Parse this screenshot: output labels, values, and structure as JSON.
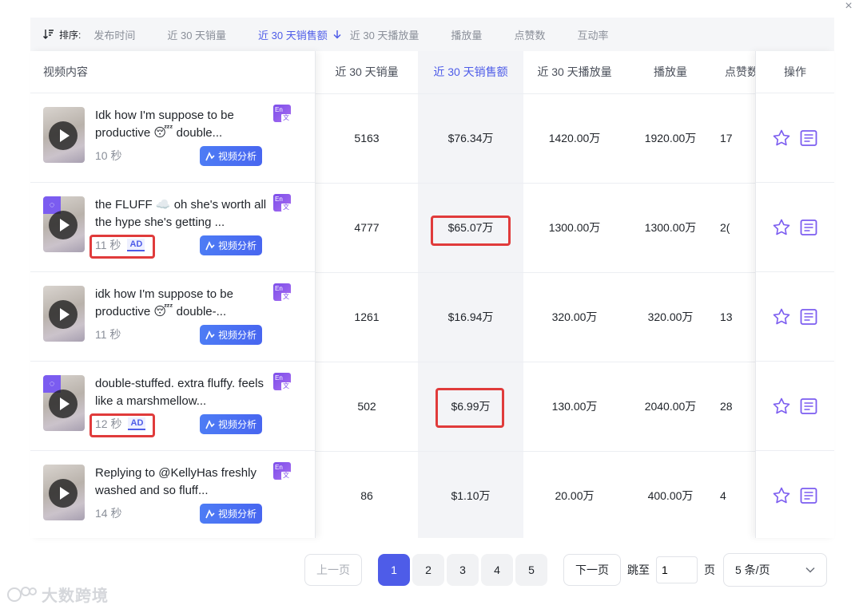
{
  "close_icon": "×",
  "sort": {
    "label": "排序:",
    "options": [
      "发布时间",
      "近 30 天销量",
      "近 30 天销售额",
      "近 30 天播放量",
      "播放量",
      "点赞数",
      "互动率"
    ],
    "active_index": 2
  },
  "table": {
    "left_header": "视频内容",
    "columns": [
      "近 30 天销量",
      "近 30 天销售额",
      "近 30 天播放量",
      "播放量",
      "点赞数"
    ],
    "action_header": "操作",
    "rows": [
      {
        "title": "Idk how I'm suppose to be productive 😴 double...",
        "duration": "10 秒",
        "ad": false,
        "ad_label": "",
        "sales": "5163",
        "revenue": "$76.34万",
        "plays30": "1420.00万",
        "plays": "1920.00万",
        "likes": "17"
      },
      {
        "title": "the FLUFF ☁️ oh she's worth all the hype she's getting ...",
        "duration": "11 秒",
        "ad": true,
        "ad_label": "AD",
        "sales": "4777",
        "revenue": "$65.07万",
        "plays30": "1300.00万",
        "plays": "1300.00万",
        "likes": "2("
      },
      {
        "title": "idk how I'm suppose to be productive 😴 double-...",
        "duration": "11 秒",
        "ad": false,
        "ad_label": "",
        "sales": "1261",
        "revenue": "$16.94万",
        "plays30": "320.00万",
        "plays": "320.00万",
        "likes": "13"
      },
      {
        "title": "double-stuffed. extra fluffy. feels like a marshmellow...",
        "duration": "12 秒",
        "ad": true,
        "ad_label": "AD",
        "sales": "502",
        "revenue": "$6.99万",
        "plays30": "130.00万",
        "plays": "2040.00万",
        "likes": "28"
      },
      {
        "title": "Replying to @KellyHas freshly washed and so fluff...",
        "duration": "14 秒",
        "ad": false,
        "ad_label": "",
        "sales": "86",
        "revenue": "$1.10万",
        "plays30": "20.00万",
        "plays": "400.00万",
        "likes": "4"
      }
    ],
    "analyze_label": "视频分析",
    "translate_top": "En",
    "translate_bottom": "文"
  },
  "pagination": {
    "prev": "上一页",
    "pages": [
      "1",
      "2",
      "3",
      "4",
      "5"
    ],
    "current": "1",
    "next": "下一页",
    "jump_label": "跳至",
    "jump_value": "1",
    "page_unit": "页",
    "page_size": "5 条/页"
  },
  "watermark": "大数跨境",
  "colors": {
    "accent": "#4e5ce8",
    "highlight_box": "#e03b3b",
    "ad_purple": "#7b5cf0"
  }
}
